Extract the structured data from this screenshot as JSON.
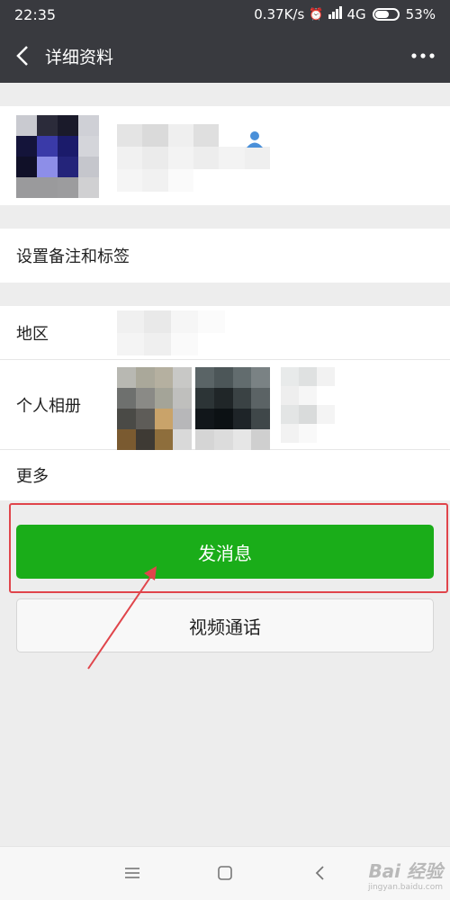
{
  "status_bar": {
    "time": "22:35",
    "net_speed": "0.37K/s",
    "network": "4G",
    "battery": "53%",
    "battery_level": 0.53
  },
  "nav": {
    "title": "详细资料"
  },
  "rows": {
    "remark": "设置备注和标签",
    "region": "地区",
    "moments": "个人相册",
    "more": "更多"
  },
  "buttons": {
    "send_message": "发消息",
    "video_call": "视频通话"
  },
  "watermark": {
    "main": "Bai 经验",
    "sub": "jingyan.baidu.com"
  },
  "colors": {
    "header_bg": "#393a3f",
    "primary_green": "#1aad19",
    "annotation_red": "#e0454b"
  }
}
